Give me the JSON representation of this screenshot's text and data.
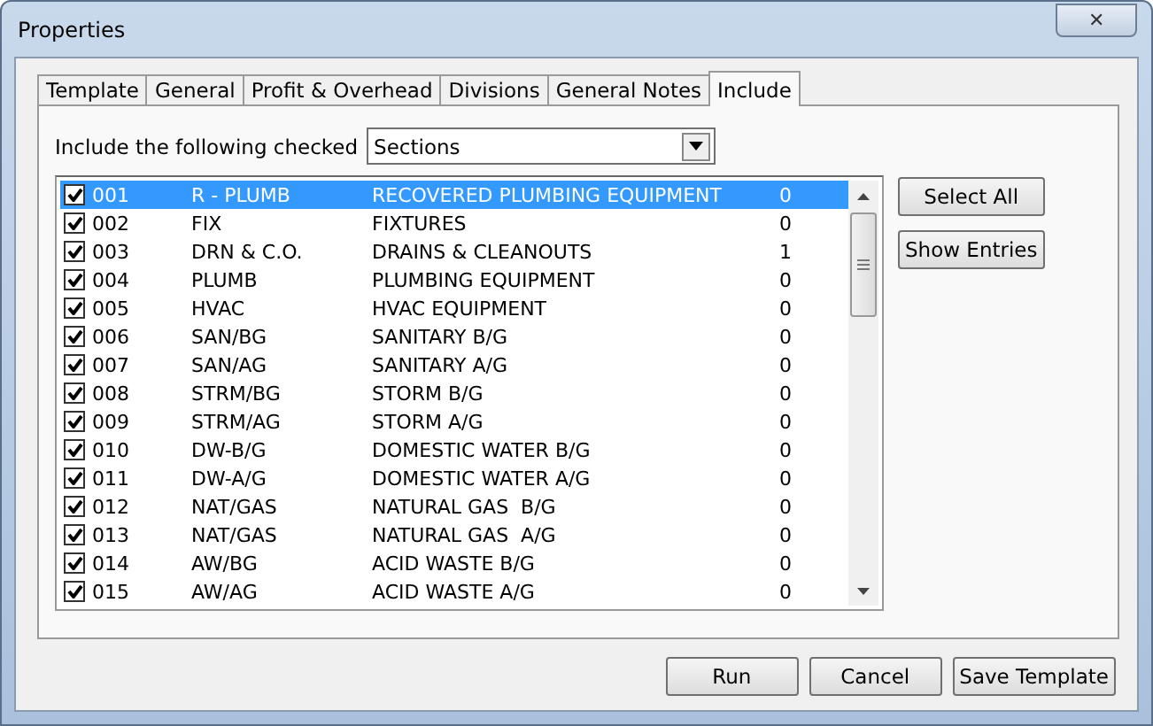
{
  "window": {
    "title": "Properties",
    "close": "✕"
  },
  "tabs": [
    {
      "label": "Template",
      "selected": false
    },
    {
      "label": "General",
      "selected": false
    },
    {
      "label": "Profit & Overhead",
      "selected": false
    },
    {
      "label": "Divisions",
      "selected": false
    },
    {
      "label": "General Notes",
      "selected": false
    },
    {
      "label": "Include",
      "selected": true
    }
  ],
  "include": {
    "label": "Include the following checked",
    "value": "Sections"
  },
  "rows": [
    {
      "code": "001",
      "abbr": "R - PLUMB",
      "name": "RECOVERED PLUMBING EQUIPMENT",
      "count": "0",
      "checked": true,
      "selected": true
    },
    {
      "code": "002",
      "abbr": "FIX",
      "name": "FIXTURES",
      "count": "0",
      "checked": true,
      "selected": false
    },
    {
      "code": "003",
      "abbr": "DRN & C.O.",
      "name": "DRAINS & CLEANOUTS",
      "count": "1",
      "checked": true,
      "selected": false
    },
    {
      "code": "004",
      "abbr": "PLUMB",
      "name": "PLUMBING EQUIPMENT",
      "count": "0",
      "checked": true,
      "selected": false
    },
    {
      "code": "005",
      "abbr": "HVAC",
      "name": "HVAC EQUIPMENT",
      "count": "0",
      "checked": true,
      "selected": false
    },
    {
      "code": "006",
      "abbr": "SAN/BG",
      "name": "SANITARY B/G",
      "count": "0",
      "checked": true,
      "selected": false
    },
    {
      "code": "007",
      "abbr": "SAN/AG",
      "name": "SANITARY A/G",
      "count": "0",
      "checked": true,
      "selected": false
    },
    {
      "code": "008",
      "abbr": "STRM/BG",
      "name": "STORM B/G",
      "count": "0",
      "checked": true,
      "selected": false
    },
    {
      "code": "009",
      "abbr": "STRM/AG",
      "name": "STORM A/G",
      "count": "0",
      "checked": true,
      "selected": false
    },
    {
      "code": "010",
      "abbr": "DW-B/G",
      "name": "DOMESTIC WATER B/G",
      "count": "0",
      "checked": true,
      "selected": false
    },
    {
      "code": "011",
      "abbr": "DW-A/G",
      "name": "DOMESTIC WATER A/G",
      "count": "0",
      "checked": true,
      "selected": false
    },
    {
      "code": "012",
      "abbr": "NAT/GAS",
      "name": "NATURAL GAS  B/G",
      "count": "0",
      "checked": true,
      "selected": false
    },
    {
      "code": "013",
      "abbr": "NAT/GAS",
      "name": "NATURAL GAS  A/G",
      "count": "0",
      "checked": true,
      "selected": false
    },
    {
      "code": "014",
      "abbr": "AW/BG",
      "name": "ACID WASTE B/G",
      "count": "0",
      "checked": true,
      "selected": false
    },
    {
      "code": "015",
      "abbr": "AW/AG",
      "name": "ACID WASTE A/G",
      "count": "0",
      "checked": true,
      "selected": false
    }
  ],
  "side_buttons": [
    "Select All",
    "Show Entries"
  ],
  "buttons": [
    "Run",
    "Cancel",
    "Save Template"
  ]
}
